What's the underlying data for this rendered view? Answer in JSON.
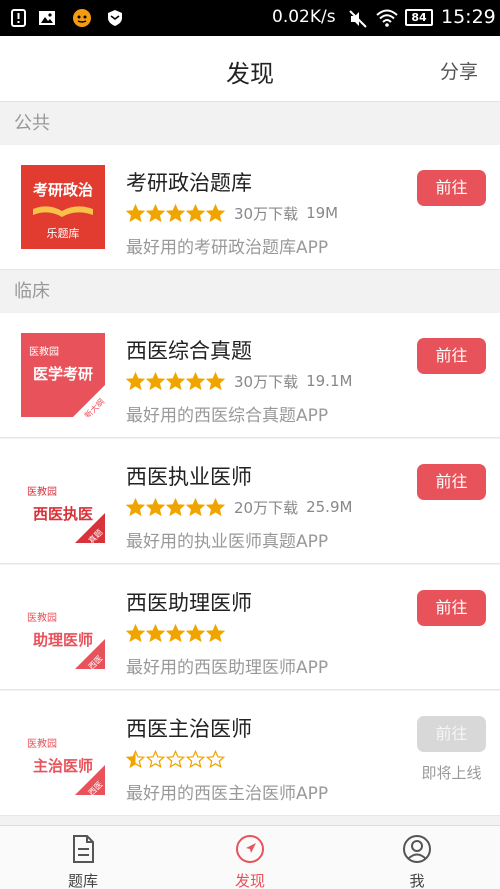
{
  "status_bar": {
    "speed": "0.02K/s",
    "battery": "84",
    "time": "15:29"
  },
  "header": {
    "title": "发现",
    "share": "分享"
  },
  "sections": [
    {
      "label": "公共"
    },
    {
      "label": "临床"
    }
  ],
  "apps": [
    {
      "name": "考研政治题库",
      "downloads": "30万下载",
      "size": "19M",
      "desc": "最好用的考研政治题库APP",
      "rating": 5,
      "button": "前往",
      "enabled": true,
      "icon": {
        "style": "red-book",
        "line1": "考研政治",
        "line2": "乐题库",
        "corner": ""
      }
    },
    {
      "name": "西医综合真题",
      "downloads": "30万下载",
      "size": "19.1M",
      "desc": "最好用的西医综合真题APP",
      "rating": 5,
      "button": "前往",
      "enabled": true,
      "icon": {
        "style": "red-fill",
        "brand": "医教园",
        "line1": "医学考研",
        "corner": "新大纲"
      }
    },
    {
      "name": "西医执业医师",
      "downloads": "20万下载",
      "size": "25.9M",
      "desc": "最好用的执业医师真题APP",
      "rating": 5,
      "button": "前往",
      "enabled": true,
      "icon": {
        "style": "white",
        "brand": "医教园",
        "line1": "西医执医",
        "corner": "真题"
      }
    },
    {
      "name": "西医助理医师",
      "downloads": "",
      "size": "",
      "desc": "最好用的西医助理医师APP",
      "rating": 5,
      "button": "前往",
      "enabled": true,
      "icon": {
        "style": "white",
        "brand": "医教园",
        "line1": "助理医师",
        "corner": "西医"
      }
    },
    {
      "name": "西医主治医师",
      "downloads": "",
      "size": "",
      "desc": "最好用的西医主治医师APP",
      "rating": 0.5,
      "button": "前往",
      "enabled": false,
      "status": "即将上线",
      "icon": {
        "style": "white",
        "brand": "医教园",
        "line1": "主治医师",
        "corner": "西医"
      }
    }
  ],
  "bottom_nav": [
    {
      "label": "题库",
      "icon": "document-icon",
      "active": false
    },
    {
      "label": "发现",
      "icon": "compass-icon",
      "active": true
    },
    {
      "label": "我",
      "icon": "user-icon",
      "active": false
    }
  ],
  "colors": {
    "accent": "#e8525a",
    "star": "#f0a400",
    "disabled": "#d8d8d8"
  }
}
